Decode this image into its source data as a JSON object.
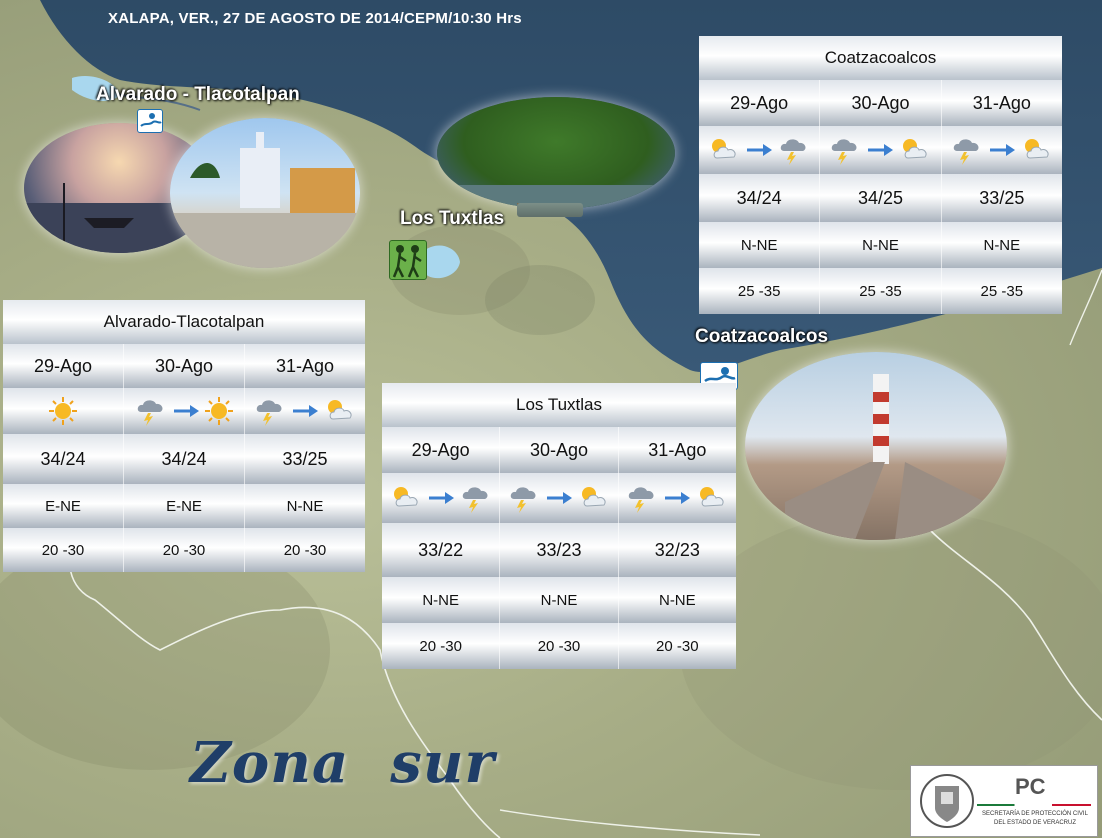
{
  "header": {
    "title": "XALAPA, VER., 27 DE AGOSTO DE 2014/CEPM/10:30 Hrs"
  },
  "map_labels": {
    "alvarado": "Alvarado - Tlacotalpan",
    "tuxtlas": "Los Tuxtlas",
    "coatza": "Coatzacoalcos"
  },
  "zone_title": "Zona  sur",
  "panels": {
    "coatza": {
      "title": "Coatzacoalcos",
      "dates": [
        "29-Ago",
        "30-Ago",
        "31-Ago"
      ],
      "weather": [
        [
          "cloud-sun-icon",
          "storm-icon"
        ],
        [
          "storm-icon",
          "cloud-sun-icon"
        ],
        [
          "storm-icon",
          "cloud-sun-icon"
        ]
      ],
      "temps": [
        "34/24",
        "34/25",
        "33/25"
      ],
      "winds": [
        "N-NE",
        "N-NE",
        "N-NE"
      ],
      "speeds": [
        "25 -35",
        "25 -35",
        "25 -35"
      ]
    },
    "alvarado": {
      "title": "Alvarado-Tlacotalpan",
      "dates": [
        "29-Ago",
        "30-Ago",
        "31-Ago"
      ],
      "weather": [
        [
          "sun-icon"
        ],
        [
          "storm-icon",
          "sun-icon"
        ],
        [
          "storm-icon",
          "cloud-sun-icon"
        ]
      ],
      "temps": [
        "34/24",
        "34/24",
        "33/25"
      ],
      "winds": [
        "E-NE",
        "E-NE",
        "N-NE"
      ],
      "speeds": [
        "20 -30",
        "20 -30",
        "20 -30"
      ]
    },
    "tuxtlas": {
      "title": "Los Tuxtlas",
      "dates": [
        "29-Ago",
        "30-Ago",
        "31-Ago"
      ],
      "weather": [
        [
          "cloud-sun-icon",
          "storm-icon"
        ],
        [
          "storm-icon",
          "cloud-sun-icon"
        ],
        [
          "storm-icon",
          "cloud-sun-icon"
        ]
      ],
      "temps": [
        "33/22",
        "33/23",
        "32/23"
      ],
      "winds": [
        "N-NE",
        "N-NE",
        "N-NE"
      ],
      "speeds": [
        "20 -30",
        "20 -30",
        "20 -30"
      ]
    }
  },
  "logo": {
    "initials": "PC",
    "line1": "SECRETARÍA DE PROTECCIÓN CIVIL",
    "line2": "DEL ESTADO DE VERACRUZ"
  }
}
